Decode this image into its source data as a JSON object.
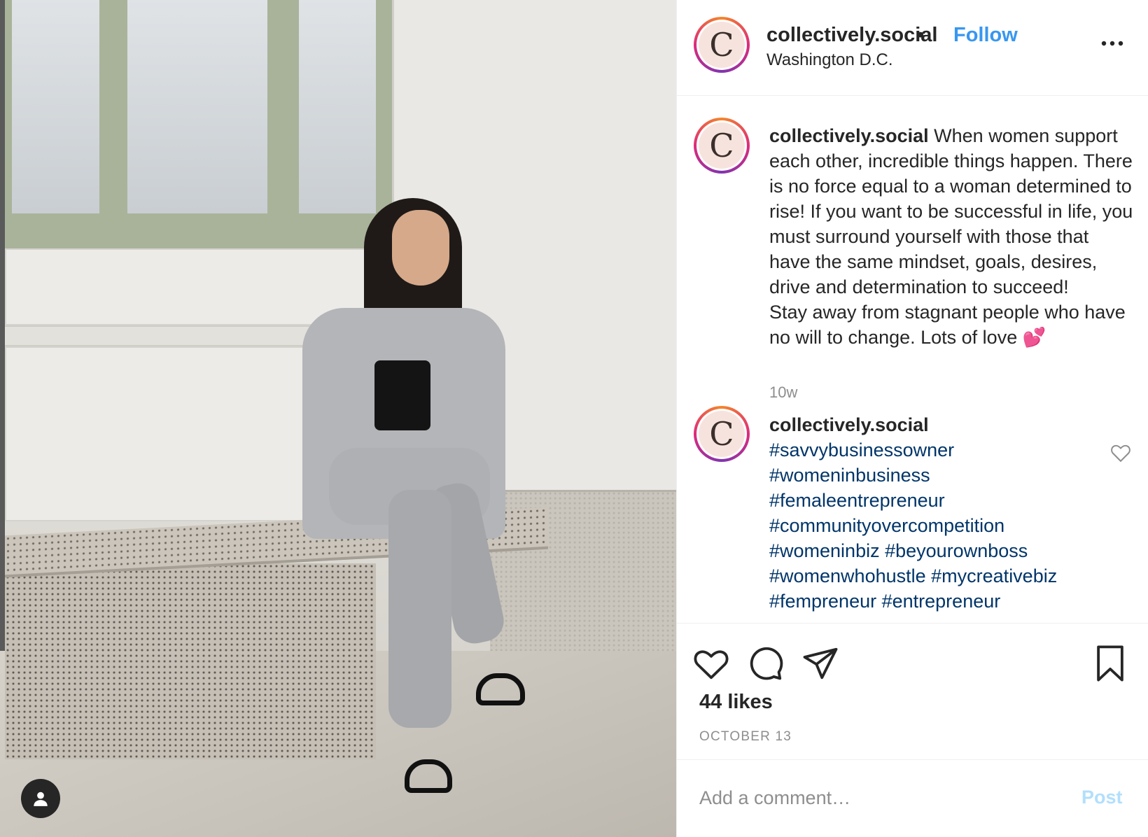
{
  "post": {
    "username": "collectively.social",
    "separator": "•",
    "follow_label": "Follow",
    "location": "Washington D.C.",
    "avatar_letter": "C"
  },
  "caption": {
    "username": "collectively.social",
    "text": "When women support each other, incredible things happen. There is no force equal to a woman determined to rise! If you want to be successful in life, you must surround yourself with those that have the same mindset, goals, desires, drive and determination to succeed!\nStay away from stagnant people who have no will to change. Lots of love 💕",
    "time": "10w"
  },
  "comment": {
    "username": "collectively.social",
    "hashtags": [
      "#savvybusinessowner",
      "#womeninbusiness",
      "#femaleentrepreneur",
      "#communityovercompetition",
      "#womeninbiz",
      "#beyourownboss",
      "#womenwhohustle",
      "#mycreativebiz",
      "#fempreneur",
      "#entrepreneur"
    ]
  },
  "stats": {
    "likes": "44 likes",
    "date": "OCTOBER 13"
  },
  "comment_box": {
    "placeholder": "Add a comment…",
    "post_label": "Post"
  },
  "colors": {
    "link_blue": "#3897f0",
    "hashtag_blue": "#003569",
    "post_disabled": "#b2dffc",
    "secondary_text": "#8e8e8e"
  },
  "icons": [
    "user-tag-icon",
    "more-options-icon",
    "heart-icon",
    "comment-icon",
    "share-icon",
    "bookmark-icon",
    "comment-like-icon"
  ]
}
